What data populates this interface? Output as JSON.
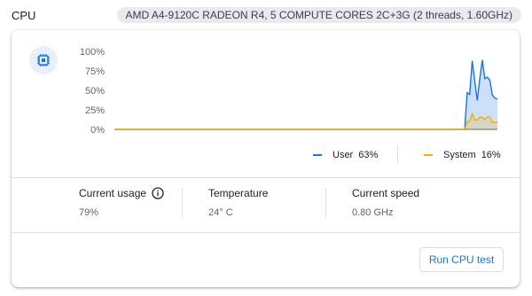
{
  "header": {
    "title": "CPU",
    "cpu_name": "AMD A4-9120C RADEON R4, 5 COMPUTE CORES 2C+3G (2 threads, 1.60GHz)"
  },
  "chip_icon": "cpu-chip-icon",
  "colors": {
    "user": "#1a73e8",
    "system": "#f9ab00",
    "accent": "#1a73e8"
  },
  "chart_data": {
    "type": "area",
    "y_ticks": [
      "100%",
      "75%",
      "50%",
      "25%",
      "0%"
    ],
    "ylim": [
      0,
      100
    ],
    "grid": false,
    "x_points": 36,
    "series": [
      {
        "name": "User",
        "values": [
          0,
          0,
          0,
          0,
          0,
          0,
          0,
          0,
          0,
          0,
          0,
          0,
          0,
          0,
          0,
          0,
          0,
          0,
          0,
          0,
          0,
          0,
          0,
          0,
          0,
          0,
          0,
          0,
          0,
          0,
          0,
          0,
          0,
          0,
          0,
          0,
          0,
          0,
          0,
          0,
          0,
          0,
          0,
          0,
          0,
          0,
          0,
          0,
          0,
          0,
          0,
          0,
          0,
          0,
          0,
          0,
          0,
          0,
          0,
          0,
          0,
          0,
          0,
          0,
          0,
          0,
          0,
          0,
          0,
          0,
          0,
          0,
          0,
          0,
          0,
          0,
          0,
          0,
          0,
          0,
          0,
          0,
          0,
          0,
          0,
          0,
          0,
          0,
          0,
          0,
          0,
          0,
          0,
          0,
          0,
          0,
          0,
          0,
          0,
          0,
          0,
          0,
          0,
          0,
          0,
          0,
          0,
          0,
          0,
          0,
          0,
          0,
          0,
          0,
          0,
          0,
          0,
          0,
          0,
          0,
          0,
          0,
          0,
          0,
          0,
          0,
          0,
          0,
          0,
          0,
          0,
          0,
          0,
          0,
          0,
          0,
          0,
          0,
          0,
          0,
          47,
          45,
          88,
          62,
          37,
          65,
          89,
          65,
          67,
          63,
          44,
          40,
          39
        ]
      },
      {
        "name": "System",
        "values": [
          0,
          0,
          0,
          0,
          0,
          0,
          0,
          0,
          0,
          0,
          0,
          0,
          0,
          0,
          0,
          0,
          0,
          0,
          0,
          0,
          0,
          0,
          0,
          0,
          0,
          0,
          0,
          0,
          0,
          0,
          0,
          0,
          0,
          0,
          0,
          0,
          0,
          0,
          0,
          0,
          0,
          0,
          0,
          0,
          0,
          0,
          0,
          0,
          0,
          0,
          0,
          0,
          0,
          0,
          0,
          0,
          0,
          0,
          0,
          0,
          0,
          0,
          0,
          0,
          0,
          0,
          0,
          0,
          0,
          0,
          0,
          0,
          0,
          0,
          0,
          0,
          0,
          0,
          0,
          0,
          0,
          0,
          0,
          0,
          0,
          0,
          0,
          0,
          0,
          0,
          0,
          0,
          0,
          0,
          0,
          0,
          0,
          0,
          0,
          0,
          0,
          0,
          0,
          0,
          0,
          0,
          0,
          0,
          0,
          0,
          0,
          0,
          0,
          0,
          0,
          0,
          0,
          0,
          0,
          0,
          0,
          0,
          0,
          0,
          0,
          0,
          0,
          0,
          0,
          0,
          0,
          0,
          0,
          0,
          0,
          0,
          0,
          0,
          0,
          0,
          10,
          10,
          20,
          12,
          12,
          16,
          15,
          13,
          16,
          16,
          9,
          9,
          9
        ]
      }
    ]
  },
  "legend": {
    "user_label": "User",
    "user_value": "63%",
    "system_label": "System",
    "system_value": "16%"
  },
  "stats": {
    "usage_label": "Current usage",
    "usage_value": "79%",
    "temp_label": "Temperature",
    "temp_value": "24° C",
    "speed_label": "Current speed",
    "speed_value": "0.80 GHz"
  },
  "actions": {
    "run_test": "Run CPU test"
  }
}
